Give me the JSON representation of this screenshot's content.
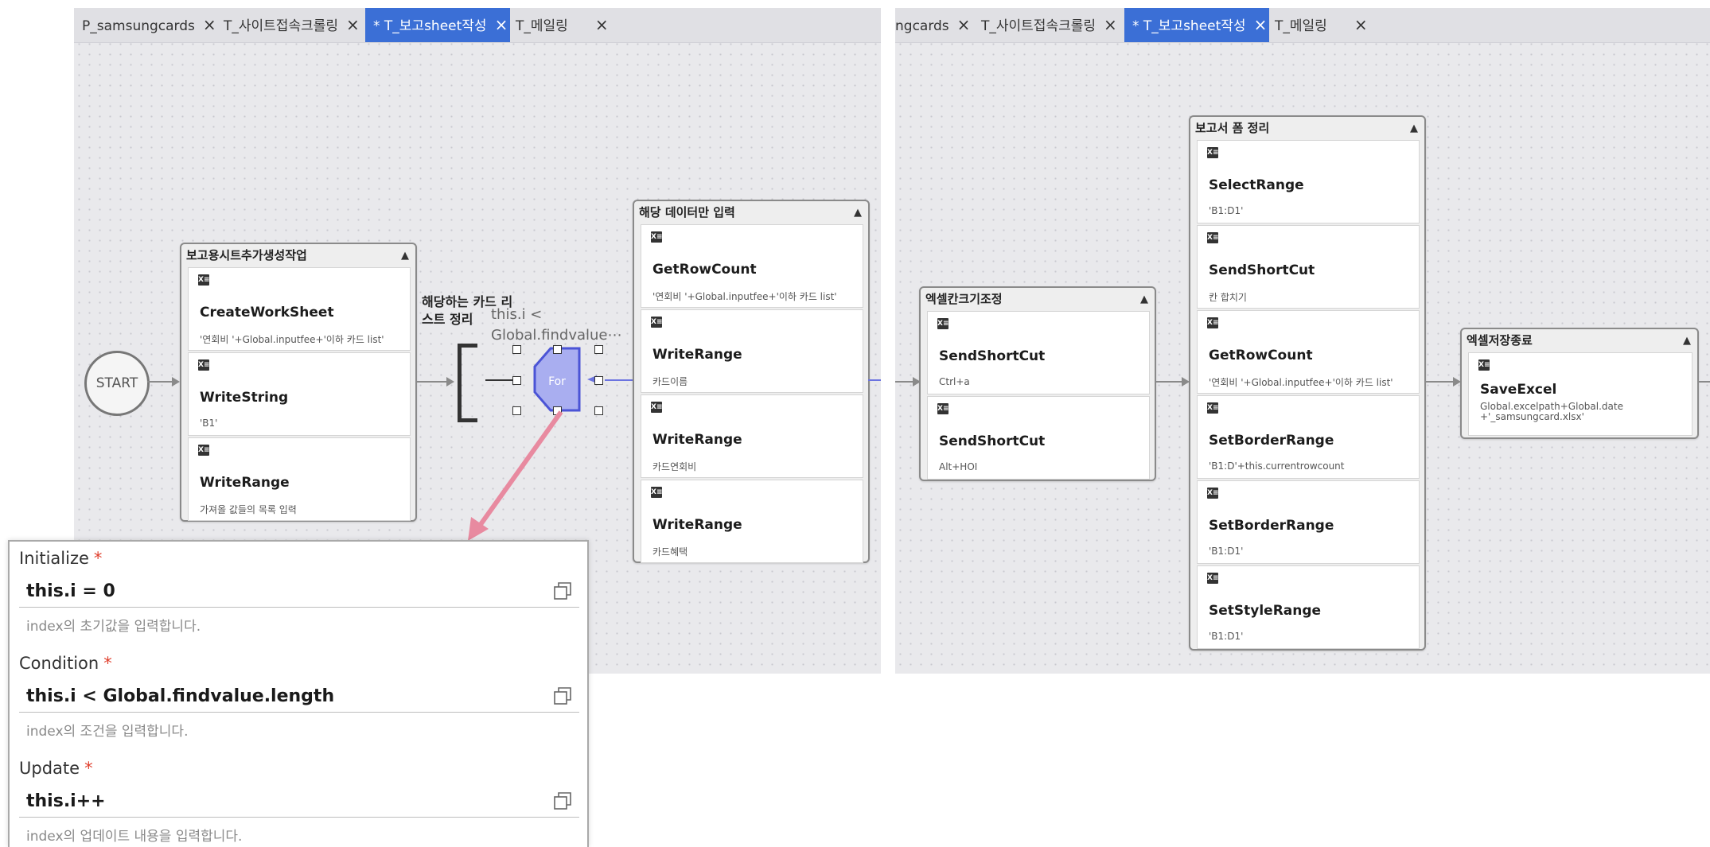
{
  "left_panel": {
    "tabs": [
      {
        "label": "P_samsungcards",
        "active": false
      },
      {
        "label": "T_사이트접속크롤링",
        "active": false
      },
      {
        "label": "* T_보고sheet작성",
        "active": true
      },
      {
        "label": "T_메일링",
        "active": false
      }
    ],
    "start_label": "START",
    "group1": {
      "title": "보고용시트추가생성작업",
      "steps": [
        {
          "name": "CreateWorkSheet",
          "param": "'연회비 '+Global.inputfee+'이하 카드 list'"
        },
        {
          "name": "WriteString",
          "param": "'B1'"
        },
        {
          "name": "WriteRange",
          "param": "가져올 값들의 목록 입력"
        }
      ]
    },
    "for_label": "해당하는 카드 리스트 정리",
    "for_condition": "this.i < Global.findvalue⋯",
    "for_node_text": "For",
    "group2": {
      "title": "해당 데이터만 입력",
      "steps": [
        {
          "name": "GetRowCount",
          "param": "'연회비 '+Global.inputfee+'이하 카드 list'"
        },
        {
          "name": "WriteRange",
          "param": "카드이름"
        },
        {
          "name": "WriteRange",
          "param": "카드연회비"
        },
        {
          "name": "WriteRange",
          "param": "카드혜택"
        }
      ]
    }
  },
  "right_panel": {
    "tabs": [
      {
        "label": "ngcards",
        "active": false
      },
      {
        "label": "T_사이트접속크롤링",
        "active": false
      },
      {
        "label": "* T_보고sheet작성",
        "active": true
      },
      {
        "label": "T_메일링",
        "active": false
      }
    ],
    "group3": {
      "title": "엑셀칸크기조정",
      "steps": [
        {
          "name": "SendShortCut",
          "param": "Ctrl+a"
        },
        {
          "name": "SendShortCut",
          "param": "Alt+HOI"
        }
      ]
    },
    "group4": {
      "title": "보고서 폼 정리",
      "steps": [
        {
          "name": "SelectRange",
          "param": "'B1:D1'"
        },
        {
          "name": "SendShortCut",
          "param": "칸 합치기"
        },
        {
          "name": "GetRowCount",
          "param": "'연회비 '+Global.inputfee+'이하 카드 list'"
        },
        {
          "name": "SetBorderRange",
          "param": "'B1:D'+this.currentrowcount"
        },
        {
          "name": "SetBorderRange",
          "param": "'B1:D1'"
        },
        {
          "name": "SetStyleRange",
          "param": "'B1:D1'"
        }
      ]
    },
    "group5": {
      "title": "엑셀저장종료",
      "steps": [
        {
          "name": "SaveExcel",
          "param": "Global.excelpath+Global.date +'_samsungcard.xlsx'"
        }
      ]
    }
  },
  "form": {
    "initialize": {
      "label": "Initialize",
      "value": "this.i = 0",
      "hint": "index의 초기값을 입력합니다."
    },
    "condition": {
      "label": "Condition",
      "value": "this.i < Global.findvalue.length",
      "hint": "index의 조건을 입력합니다."
    },
    "update": {
      "label": "Update",
      "value": "this.i++",
      "hint": "index의 업데이트 내용을 입력합니다."
    },
    "required_mark": "*"
  },
  "icons": {
    "close": "×",
    "collapse": "▲",
    "excel": "X≡"
  },
  "colors": {
    "accent": "#3b6fd6",
    "for_node": "#a9aef0",
    "arrow_pink": "#e88aa0",
    "required": "#e0402e"
  }
}
